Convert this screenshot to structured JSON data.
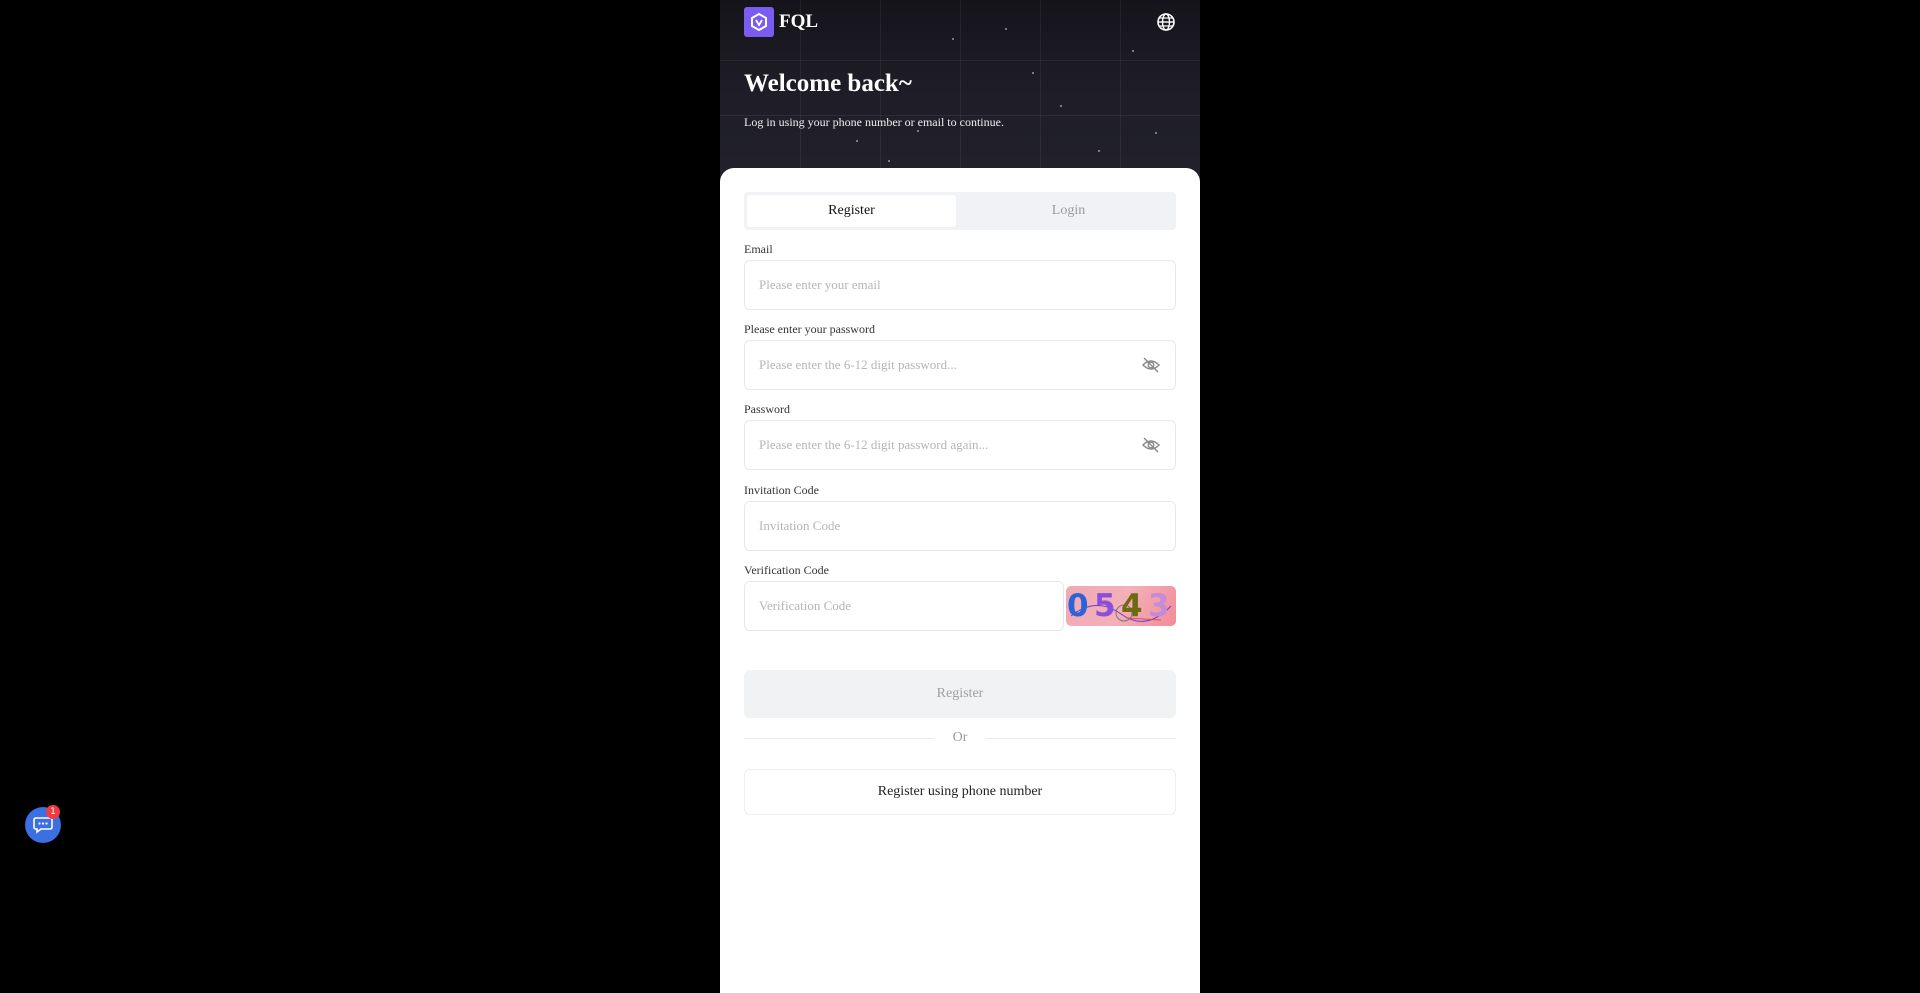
{
  "header": {
    "brand": "FQL",
    "welcome": "Welcome back~",
    "subtitle": "Log in using your phone number or email to continue."
  },
  "tabs": [
    {
      "label": "Register",
      "active": true
    },
    {
      "label": "Login",
      "active": false
    }
  ],
  "form": {
    "email": {
      "label": "Email",
      "placeholder": "Please enter your email",
      "value": ""
    },
    "password": {
      "label": "Please enter your password",
      "placeholder": "Please enter the 6-12 digit password...",
      "value": ""
    },
    "confirm_password": {
      "label": "Password",
      "placeholder": "Please enter the 6-12 digit password again...",
      "value": ""
    },
    "invitation": {
      "label": "Invitation Code",
      "placeholder": "Invitation Code",
      "value": ""
    },
    "verification": {
      "label": "Verification Code",
      "placeholder": "Verification Code",
      "value": ""
    },
    "captcha_chars": [
      "0",
      "5",
      "4",
      "3"
    ]
  },
  "buttons": {
    "register": "Register",
    "divider": "Or",
    "phone_register": "Register using phone number"
  },
  "chat": {
    "badge_count": "1"
  },
  "icons": {
    "logo": "cube-logo-icon",
    "language": "globe-icon",
    "password_toggle": "eye-off-icon",
    "support": "chat-icon"
  },
  "colors": {
    "accent": "#7b5cf0",
    "chat": "#3c6fe2",
    "badge": "#f23b3b"
  }
}
